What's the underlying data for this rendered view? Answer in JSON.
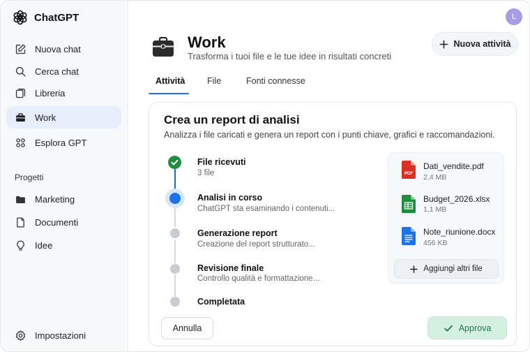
{
  "app": {
    "name": "ChatGPT",
    "avatar_initial": "L",
    "avatar_color": "#a99ee6"
  },
  "sidebar": {
    "items": [
      {
        "label": "Nuova chat",
        "icon": "edit-icon"
      },
      {
        "label": "Cerca chat",
        "icon": "search-icon"
      },
      {
        "label": "Libreria",
        "icon": "library-icon"
      },
      {
        "label": "Work",
        "icon": "briefcase-icon",
        "active": true
      },
      {
        "label": "Esplora GPT",
        "icon": "grid-icon"
      }
    ],
    "section_label": "Progetti",
    "projects": [
      {
        "label": "Marketing",
        "icon": "folder-icon"
      },
      {
        "label": "Documenti",
        "icon": "document-icon"
      },
      {
        "label": "Idee",
        "icon": "lightbulb-icon"
      }
    ],
    "settings_label": "Impostazioni"
  },
  "header": {
    "title": "Work",
    "subtitle": "Trasforma i tuoi file e le tue idee in risultati concreti",
    "new_task_label": "Nuova attività"
  },
  "tabs": [
    {
      "label": "Attività",
      "active": true
    },
    {
      "label": "File"
    },
    {
      "label": "Fonti connesse"
    }
  ],
  "task": {
    "title": "Crea un report di analisi",
    "description": "Analizza i file caricati e genera un report con i punti chiave, grafici e raccomandazioni.",
    "steps": [
      {
        "title": "File ricevuti",
        "subtitle": "3 file",
        "status": "done"
      },
      {
        "title": "Analisi in corso",
        "subtitle": "ChatGPT sta esaminando i contenuti...",
        "status": "active"
      },
      {
        "title": "Generazione report",
        "subtitle": "Creazione del report strutturato...",
        "status": "pending"
      },
      {
        "title": "Revisione finale",
        "subtitle": "Controllo qualità e formattazione...",
        "status": "pending"
      },
      {
        "title": "Completata",
        "subtitle": "",
        "status": "pending"
      }
    ],
    "files": [
      {
        "name": "Dati_vendite.pdf",
        "size": "2,4 MB",
        "type": "pdf",
        "badge": "PDF",
        "color": "#d93025"
      },
      {
        "name": "Budget_2026.xlsx",
        "size": "1,1 MB",
        "type": "sheet",
        "color": "#1e8e3e"
      },
      {
        "name": "Note_riunione.docx",
        "size": "456 KB",
        "type": "doc",
        "color": "#1a73e8"
      }
    ],
    "add_files_label": "Aggiungi altri file",
    "cancel_label": "Annulla",
    "approve_label": "Approva"
  },
  "colors": {
    "accent": "#1a73e8",
    "success": "#1e8e3e",
    "approve_bg": "#d4f0e0"
  }
}
